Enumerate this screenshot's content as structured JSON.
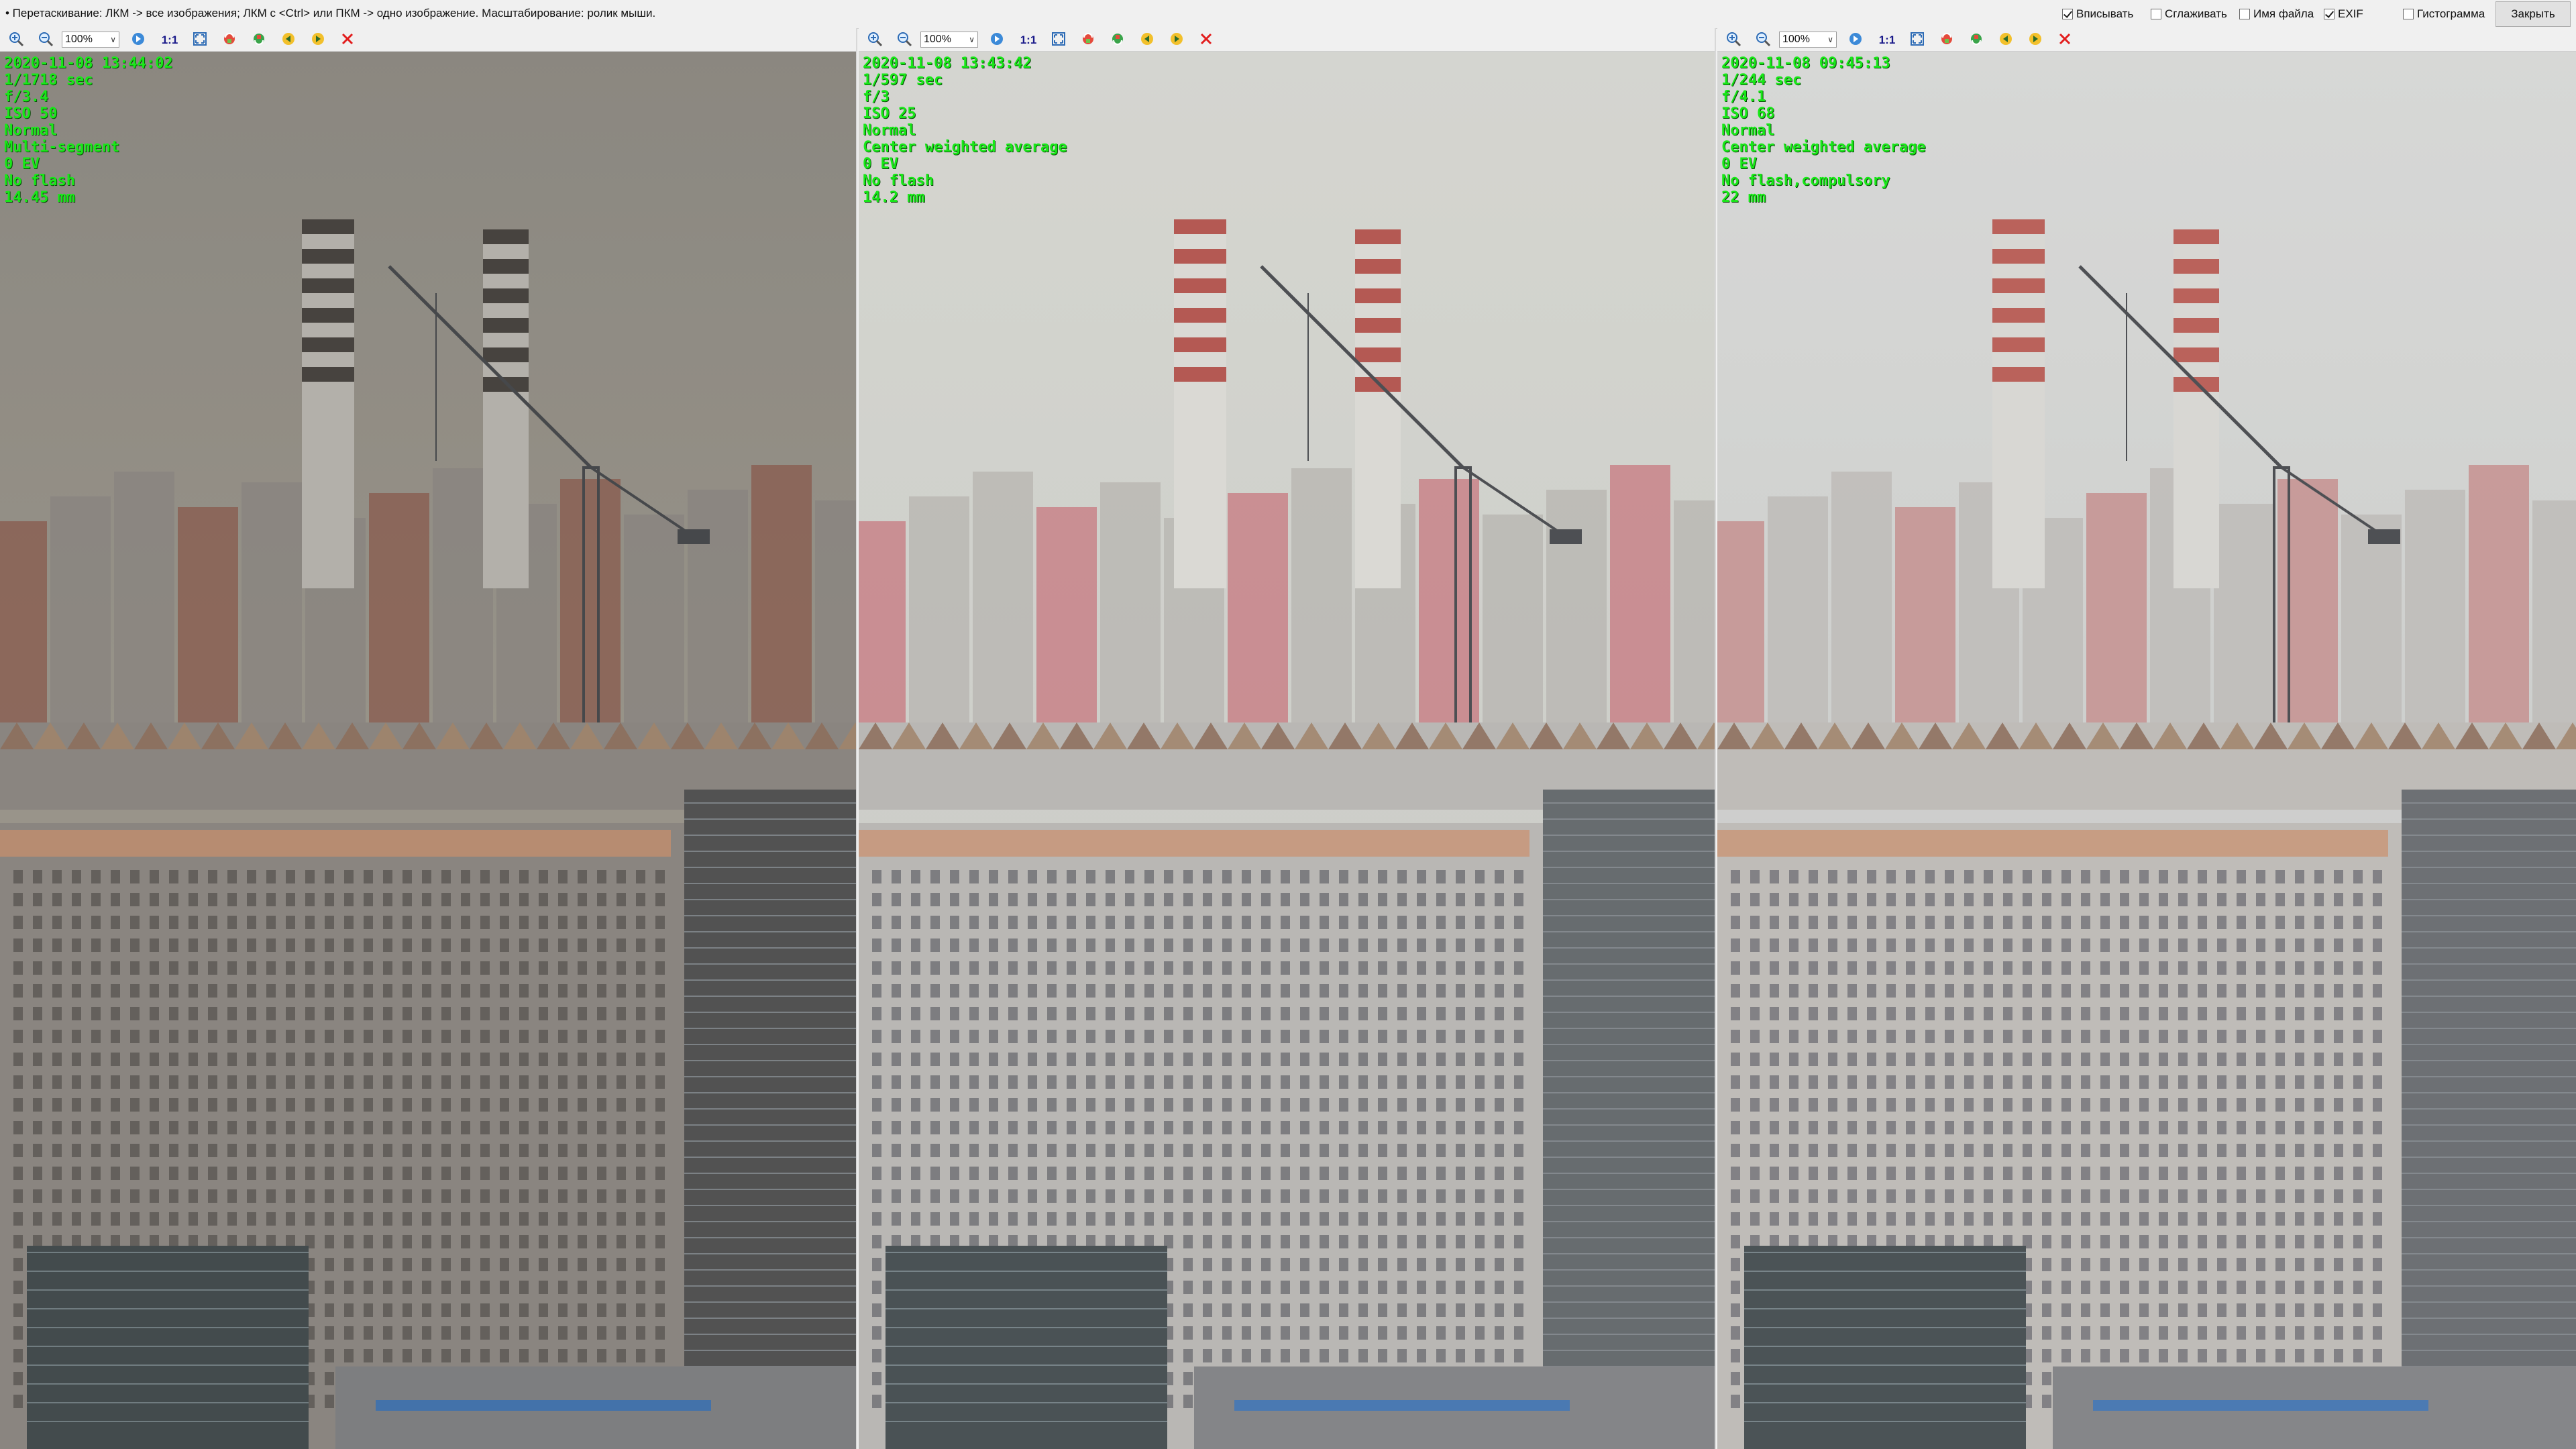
{
  "window": {
    "hint": "• Перетаскивание: ЛКМ -> все изображения; ЛКМ с <Ctrl> или ПКМ -> одно изображение. Масштабирование: ролик мыши."
  },
  "options": [
    {
      "label": "Вписывать",
      "checked": true
    },
    {
      "label": "Сглаживать",
      "checked": false
    },
    {
      "label": "Имя файла",
      "checked": false
    },
    {
      "label": "EXIF",
      "checked": true
    },
    {
      "label": "Гистограмма",
      "checked": false
    }
  ],
  "close_label": "Закрыть",
  "toolbar": {
    "zoom_value": "100%",
    "one_to_one": "1:1",
    "icons": [
      "zoom-in-icon",
      "zoom-out-icon",
      "next-icon",
      "one-to-one",
      "fit-icon",
      "rotate-left-icon",
      "rotate-right-icon",
      "prev-image-icon",
      "next-image-icon",
      "close-icon"
    ]
  },
  "panels": [
    {
      "exif": [
        "2020-11-08 13:44:02",
        "1/1718 sec",
        "f/3.4",
        "ISO 50",
        "Normal",
        "Multi-segment",
        "0 EV",
        "No flash",
        "14.45 mm"
      ],
      "tint": "#8f8a80"
    },
    {
      "exif": [
        "2020-11-08 13:43:42",
        "1/597 sec",
        "f/3",
        "ISO 25",
        "Normal",
        "Center weighted average",
        "0 EV",
        "No flash",
        "14.2 mm"
      ],
      "tint": "#c7c8c2"
    },
    {
      "exif": [
        "2020-11-08 09:45:13",
        "1/244 sec",
        "f/4.1",
        "ISO 68",
        "Normal",
        "Center weighted average",
        "0 EV",
        "No flash,compulsory",
        "22 mm"
      ],
      "tint": "#d0d1cf"
    }
  ]
}
